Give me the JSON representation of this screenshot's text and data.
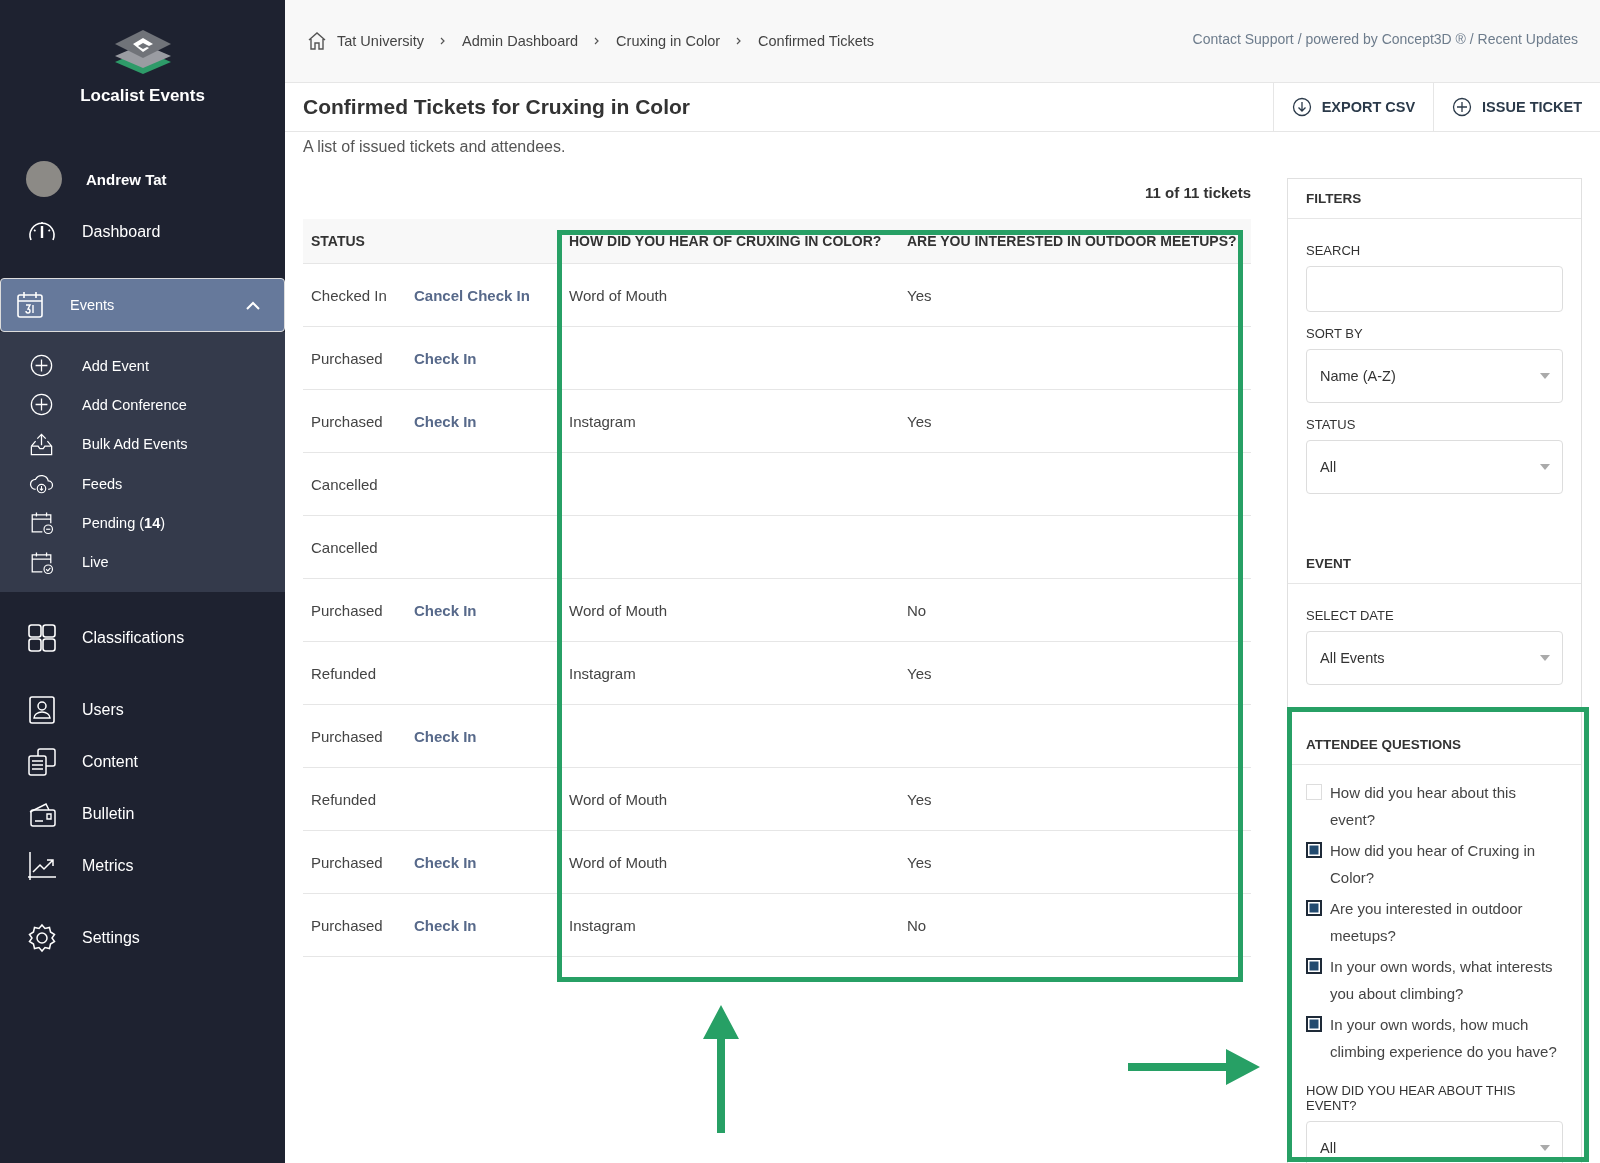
{
  "app": {
    "name": "Localist Events"
  },
  "user": {
    "name": "Andrew Tat"
  },
  "nav": [
    {
      "label": "Dashboard",
      "kind": "dashboard",
      "selected": false
    },
    {
      "label": "Events",
      "kind": "calendar",
      "selected": true,
      "expanded": true,
      "children": [
        {
          "label": "Add Event",
          "kind": "plus"
        },
        {
          "label": "Add Conference",
          "kind": "plus"
        },
        {
          "label": "Bulk Add Events",
          "kind": "upload"
        },
        {
          "label": "Feeds",
          "kind": "cloud"
        },
        {
          "label": "Pending (**14**)",
          "kind": "pending"
        },
        {
          "label": "Live",
          "kind": "live"
        }
      ]
    },
    {
      "label": "Classifications",
      "kind": "grid",
      "selected": false
    },
    {
      "label": "Users",
      "kind": "user",
      "selected": false
    },
    {
      "label": "Content",
      "kind": "content",
      "selected": false
    },
    {
      "label": "Bulletin",
      "kind": "bulletin",
      "selected": false
    },
    {
      "label": "Metrics",
      "kind": "metrics",
      "selected": false
    },
    {
      "label": "Settings",
      "kind": "settings",
      "selected": false
    }
  ],
  "breadcrumb": [
    "Tat University",
    "Admin Dashboard",
    "Cruxing in Color",
    "Confirmed Tickets"
  ],
  "top_links": "Contact Support / powered by Concept3D ® / Recent Updates",
  "title": "Confirmed Tickets for Cruxing in Color",
  "subtitle": "A list of issued tickets and attendees.",
  "actions": [
    {
      "label": "EXPORT CSV",
      "kind": "export"
    },
    {
      "label": "ISSUE TICKET",
      "kind": "add"
    }
  ],
  "count": "11 of 11 tickets",
  "table": {
    "columns": [
      "STATUS",
      "HOW DID YOU HEAR OF CRUXING IN COLOR?",
      "ARE YOU INTERESTED IN OUTDOOR MEETUPS?"
    ],
    "rows": [
      {
        "status": "Checked In",
        "action": "Cancel Check In",
        "hear": "Word of Mouth",
        "outdoor": "Yes"
      },
      {
        "status": "Purchased",
        "action": "Check In"
      },
      {
        "status": "Purchased",
        "action": "Check In",
        "hear": "Instagram",
        "outdoor": "Yes"
      },
      {
        "status": "Cancelled"
      },
      {
        "status": "Cancelled"
      },
      {
        "status": "Purchased",
        "action": "Check In",
        "hear": "Word of Mouth",
        "outdoor": "No"
      },
      {
        "status": "Refunded",
        "hear": "Instagram",
        "outdoor": "Yes"
      },
      {
        "status": "Purchased",
        "action": "Check In"
      },
      {
        "status": "Refunded",
        "hear": "Word of Mouth",
        "outdoor": "Yes"
      },
      {
        "status": "Purchased",
        "action": "Check In",
        "hear": "Word of Mouth",
        "outdoor": "Yes"
      },
      {
        "status": "Purchased",
        "action": "Check In",
        "hear": "Instagram",
        "outdoor": "No"
      }
    ]
  },
  "filters": {
    "title": "FILTERS",
    "search": {
      "label": "SEARCH"
    },
    "sort": {
      "label": "SORT BY",
      "value": "Name (A-Z)"
    },
    "status": {
      "label": "STATUS",
      "value": "All"
    },
    "event_title": "EVENT",
    "date": {
      "label": "SELECT DATE",
      "value": "All Events"
    },
    "questions_title": "ATTENDEE QUESTIONS",
    "questions": [
      {
        "label": "How did you hear about this event?",
        "checked": false
      },
      {
        "label": "How did you hear of Cruxing in Color?",
        "checked": true
      },
      {
        "label": "Are you interested in outdoor meetups?",
        "checked": true
      },
      {
        "label": "In your own words, what interests you about climbing?",
        "checked": true
      },
      {
        "label": "In your own words, how much climbing experience do you have?",
        "checked": true
      }
    ],
    "question_filter": {
      "label": "HOW DID YOU HEAR ABOUT THIS EVENT?",
      "value": "All"
    }
  }
}
